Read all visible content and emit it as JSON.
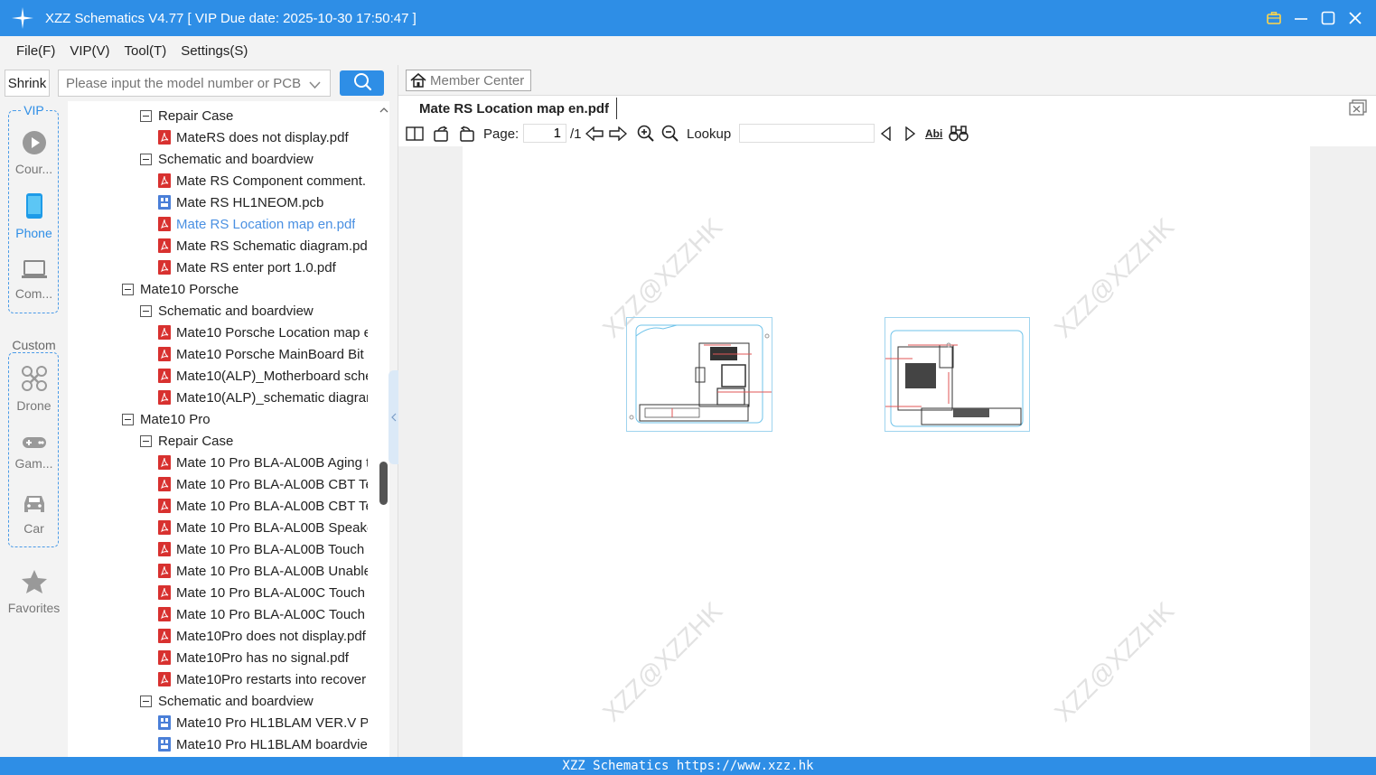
{
  "window": {
    "title": "XZZ Schematics V4.77 [ VIP Due date: 2025-10-30 17:50:47 ]"
  },
  "menu": [
    "File(F)",
    "VIP(V)",
    "Tool(T)",
    "Settings(S)"
  ],
  "search": {
    "shrink_label": "Shrink",
    "placeholder": "Please input the model number or PCB"
  },
  "sidebar": {
    "vip_group_title": "VIP",
    "vip_items": [
      {
        "label": "Cour...",
        "icon": "play-circle-icon"
      },
      {
        "label": "Phone",
        "icon": "phone-icon"
      },
      {
        "label": "Com...",
        "icon": "laptop-icon"
      }
    ],
    "custom_group_title": "Custom",
    "custom_items": [
      {
        "label": "Drone",
        "icon": "drone-icon"
      },
      {
        "label": "Gam...",
        "icon": "gamepad-icon"
      },
      {
        "label": "Car",
        "icon": "car-icon"
      }
    ],
    "favorites_label": "Favorites"
  },
  "tree": [
    {
      "label": "Repair Case",
      "type": "folder"
    },
    {
      "label": "MateRS does not display.pdf",
      "type": "pdf"
    },
    {
      "label": "Schematic and boardview",
      "type": "folder"
    },
    {
      "label": "Mate RS Component comment.",
      "type": "pdf"
    },
    {
      "label": "Mate RS HL1NEOM.pcb",
      "type": "pcb"
    },
    {
      "label": "Mate RS Location map en.pdf",
      "type": "pdf",
      "selected": true
    },
    {
      "label": "Mate RS Schematic diagram.pd",
      "type": "pdf"
    },
    {
      "label": "Mate RS enter port 1.0.pdf",
      "type": "pdf"
    },
    {
      "label": "Mate10 Porsche",
      "type": "folder"
    },
    {
      "label": "Schematic and boardview",
      "type": "folder"
    },
    {
      "label": "Mate10 Porsche Location map e",
      "type": "pdf"
    },
    {
      "label": "Mate10 Porsche MainBoard Bit",
      "type": "pdf"
    },
    {
      "label": "Mate10(ALP)_Motherboard sche",
      "type": "pdf"
    },
    {
      "label": "Mate10(ALP)_schematic diagrar",
      "type": "pdf"
    },
    {
      "label": "Mate10 Pro",
      "type": "folder"
    },
    {
      "label": "Repair Case",
      "type": "folder"
    },
    {
      "label": "Mate 10 Pro BLA-AL00B Aging t",
      "type": "pdf"
    },
    {
      "label": "Mate 10 Pro BLA-AL00B CBT Te",
      "type": "pdf"
    },
    {
      "label": "Mate 10 Pro BLA-AL00B CBT Te",
      "type": "pdf"
    },
    {
      "label": "Mate 10 Pro BLA-AL00B Speake",
      "type": "pdf"
    },
    {
      "label": "Mate 10 Pro BLA-AL00B Touch",
      "type": "pdf"
    },
    {
      "label": "Mate 10 Pro BLA-AL00B Unable",
      "type": "pdf"
    },
    {
      "label": "Mate 10 Pro BLA-AL00C Touch",
      "type": "pdf"
    },
    {
      "label": "Mate 10 Pro BLA-AL00C Touch",
      "type": "pdf"
    },
    {
      "label": "Mate10Pro does not display.pdf",
      "type": "pdf"
    },
    {
      "label": "Mate10Pro has no signal.pdf",
      "type": "pdf"
    },
    {
      "label": "Mate10Pro restarts into recover",
      "type": "pdf"
    },
    {
      "label": "Schematic and boardview",
      "type": "folder"
    },
    {
      "label": "Mate10 Pro HL1BLAM VER.V PC",
      "type": "pcb"
    },
    {
      "label": "Mate10 Pro HL1BLAM boardvie",
      "type": "pcb"
    }
  ],
  "viewer": {
    "member_center": "Member Center",
    "tab_title": "Mate RS Location map en.pdf",
    "page_label": "Page:",
    "page_value": "1",
    "page_total": "/1",
    "lookup_label": "Lookup",
    "abi_label": "Abi",
    "watermark": "XZZ@XZZHK"
  },
  "status": {
    "text": "XZZ Schematics https://www.xzz.hk"
  },
  "colors": {
    "accent": "#2e8ee6",
    "pdf_icon": "#d8312f",
    "pcb_icon": "#4a7fd8",
    "selected_text": "#4a90e2"
  }
}
